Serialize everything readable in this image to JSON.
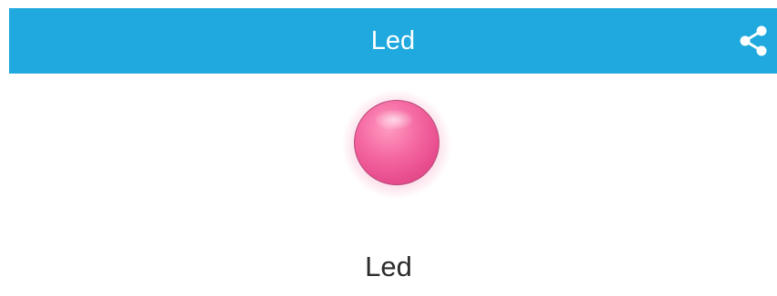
{
  "app_bar": {
    "title": "Led",
    "background_color": "#1fa9de",
    "share_icon": "share-icon"
  },
  "led": {
    "state": "on",
    "color": "#f06aa0",
    "label": "Led"
  }
}
